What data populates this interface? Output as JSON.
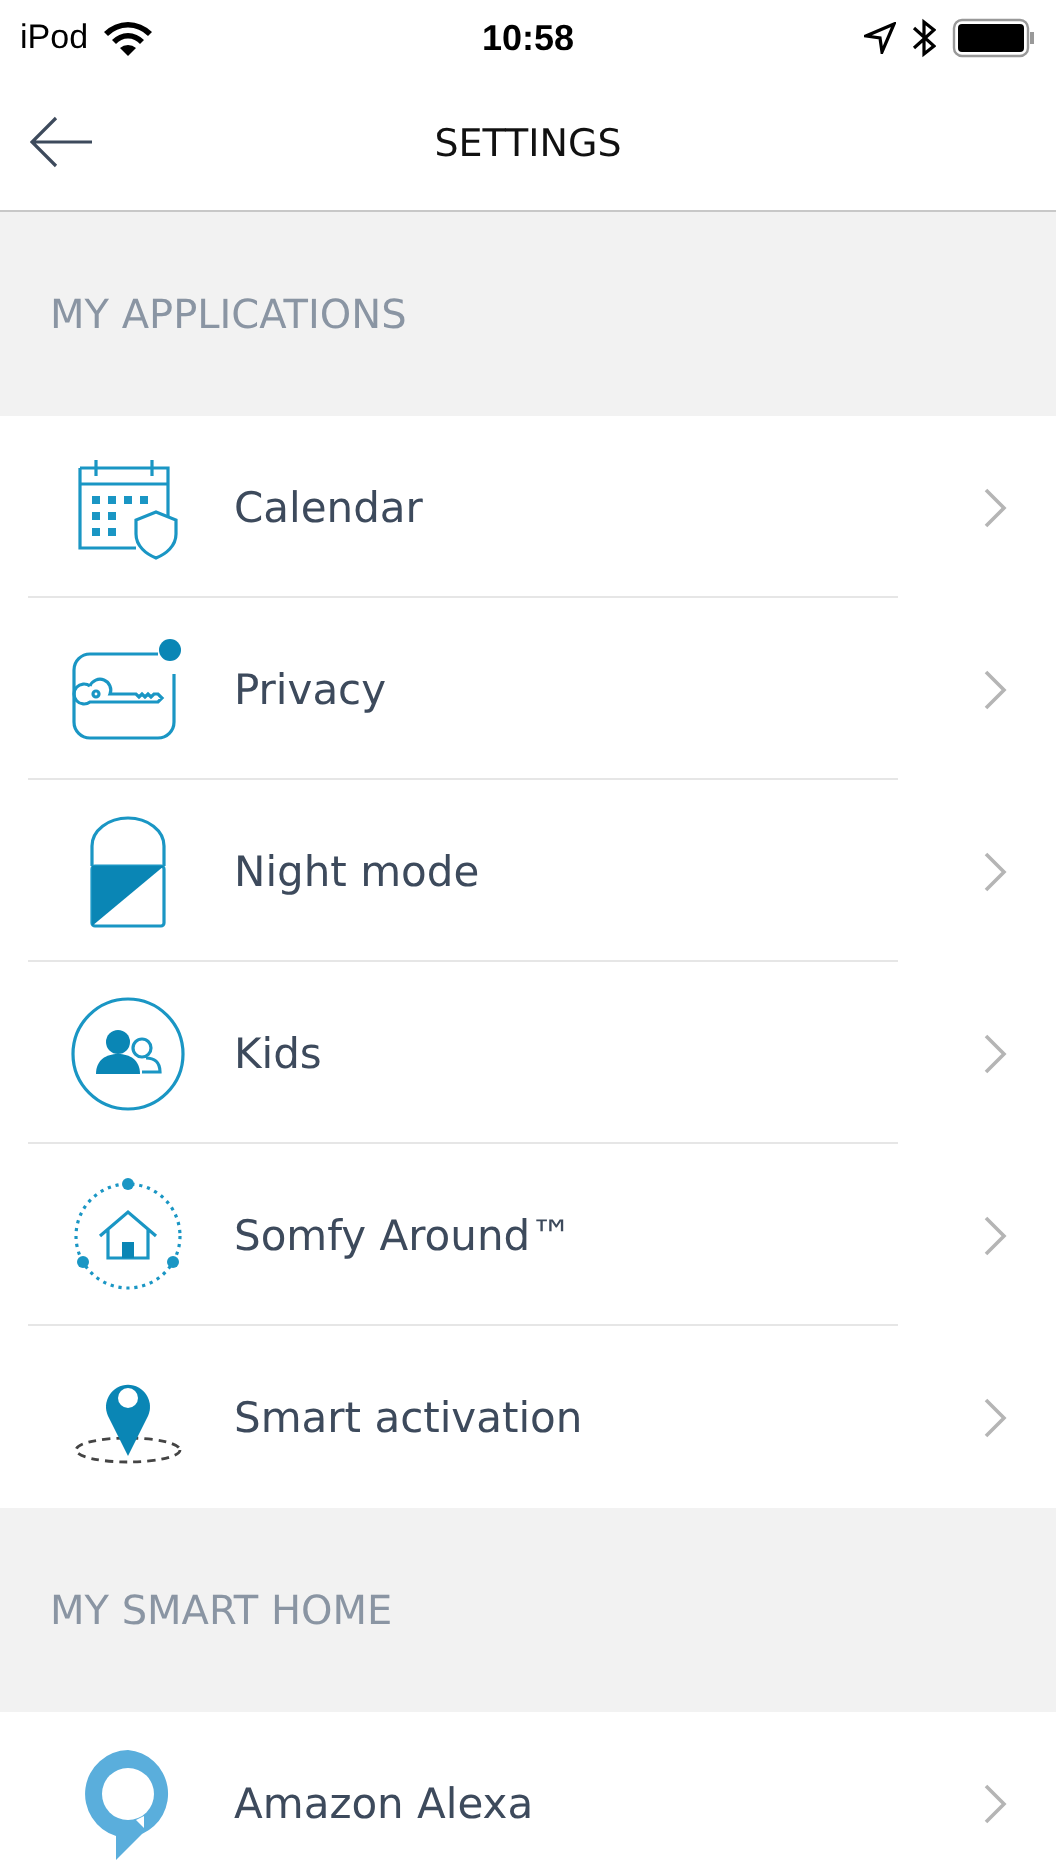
{
  "status_bar": {
    "carrier": "iPod",
    "time": "10:58"
  },
  "nav": {
    "title": "SETTINGS"
  },
  "sections": [
    {
      "title": "MY APPLICATIONS",
      "items": [
        {
          "label": "Calendar",
          "kind": "calendar"
        },
        {
          "label": "Privacy",
          "kind": "key"
        },
        {
          "label": "Night mode",
          "kind": "lock"
        },
        {
          "label": "Kids",
          "kind": "kids"
        },
        {
          "label": "Somfy Around™",
          "kind": "house"
        },
        {
          "label": "Smart activation",
          "kind": "pin"
        }
      ]
    },
    {
      "title": "MY SMART HOME",
      "items": [
        {
          "label": "Amazon Alexa",
          "kind": "bubble"
        }
      ]
    }
  ]
}
